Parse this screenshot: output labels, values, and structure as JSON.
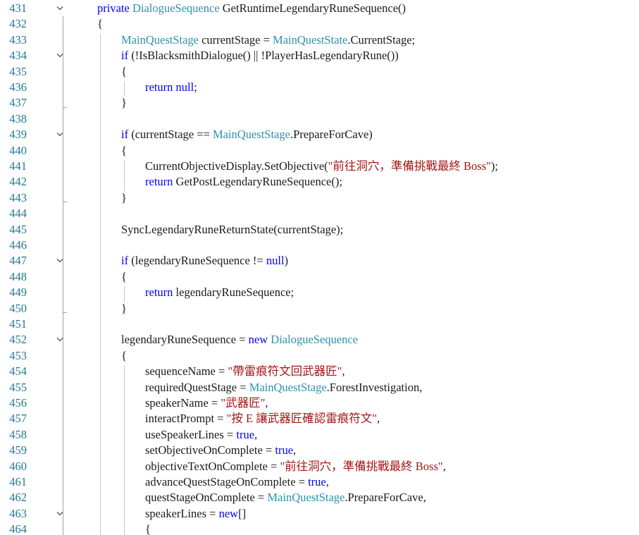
{
  "editor": {
    "language": "csharp",
    "colors": {
      "keyword": "#0000ff",
      "type": "#2b91af",
      "string": "#a31515",
      "plain": "#1a1a1a",
      "line_number": "#237893"
    },
    "lines": [
      {
        "num": "431",
        "indent": 0,
        "fold": true,
        "tokens": [
          [
            "kw",
            "private "
          ],
          [
            "type",
            "DialogueSequence"
          ],
          [
            "plain",
            " GetRuntimeLegendaryRuneSequence()"
          ]
        ]
      },
      {
        "num": "432",
        "indent": 0,
        "fold": false,
        "tokens": [
          [
            "plain",
            "{"
          ]
        ]
      },
      {
        "num": "433",
        "indent": 1,
        "fold": false,
        "tokens": [
          [
            "type",
            "MainQuestStage"
          ],
          [
            "plain",
            " currentStage = "
          ],
          [
            "type",
            "MainQuestState"
          ],
          [
            "plain",
            ".CurrentStage;"
          ]
        ]
      },
      {
        "num": "434",
        "indent": 1,
        "fold": true,
        "tokens": [
          [
            "kw",
            "if"
          ],
          [
            "plain",
            " (!IsBlacksmithDialogue() || !PlayerHasLegendaryRune())"
          ]
        ]
      },
      {
        "num": "435",
        "indent": 1,
        "fold": false,
        "tokens": [
          [
            "plain",
            "{"
          ]
        ]
      },
      {
        "num": "436",
        "indent": 2,
        "fold": false,
        "tokens": [
          [
            "kw",
            "return"
          ],
          [
            "plain",
            " "
          ],
          [
            "kw",
            "null"
          ],
          [
            "plain",
            ";"
          ]
        ]
      },
      {
        "num": "437",
        "indent": 1,
        "fold": false,
        "tokens": [
          [
            "plain",
            "}"
          ]
        ]
      },
      {
        "num": "438",
        "indent": 0,
        "fold": false,
        "tokens": []
      },
      {
        "num": "439",
        "indent": 1,
        "fold": true,
        "tokens": [
          [
            "kw",
            "if"
          ],
          [
            "plain",
            " (currentStage == "
          ],
          [
            "type",
            "MainQuestStage"
          ],
          [
            "plain",
            ".PrepareForCave)"
          ]
        ]
      },
      {
        "num": "440",
        "indent": 1,
        "fold": false,
        "tokens": [
          [
            "plain",
            "{"
          ]
        ]
      },
      {
        "num": "441",
        "indent": 2,
        "fold": false,
        "tokens": [
          [
            "plain",
            "CurrentObjectiveDisplay.SetObjective("
          ],
          [
            "str",
            "\"前往洞穴，準備挑戰最終 Boss\""
          ],
          [
            "plain",
            ");"
          ]
        ]
      },
      {
        "num": "442",
        "indent": 2,
        "fold": false,
        "tokens": [
          [
            "kw",
            "return"
          ],
          [
            "plain",
            " GetPostLegendaryRuneSequence();"
          ]
        ]
      },
      {
        "num": "443",
        "indent": 1,
        "fold": false,
        "tokens": [
          [
            "plain",
            "}"
          ]
        ]
      },
      {
        "num": "444",
        "indent": 0,
        "fold": false,
        "tokens": []
      },
      {
        "num": "445",
        "indent": 1,
        "fold": false,
        "tokens": [
          [
            "plain",
            "SyncLegendaryRuneReturnState(currentStage);"
          ]
        ]
      },
      {
        "num": "446",
        "indent": 0,
        "fold": false,
        "tokens": []
      },
      {
        "num": "447",
        "indent": 1,
        "fold": true,
        "tokens": [
          [
            "kw",
            "if"
          ],
          [
            "plain",
            " (legendaryRuneSequence != "
          ],
          [
            "kw",
            "null"
          ],
          [
            "plain",
            ")"
          ]
        ]
      },
      {
        "num": "448",
        "indent": 1,
        "fold": false,
        "tokens": [
          [
            "plain",
            "{"
          ]
        ]
      },
      {
        "num": "449",
        "indent": 2,
        "fold": false,
        "tokens": [
          [
            "kw",
            "return"
          ],
          [
            "plain",
            " legendaryRuneSequence;"
          ]
        ]
      },
      {
        "num": "450",
        "indent": 1,
        "fold": false,
        "tokens": [
          [
            "plain",
            "}"
          ]
        ]
      },
      {
        "num": "451",
        "indent": 0,
        "fold": false,
        "tokens": []
      },
      {
        "num": "452",
        "indent": 1,
        "fold": true,
        "tokens": [
          [
            "plain",
            "legendaryRuneSequence = "
          ],
          [
            "kw",
            "new"
          ],
          [
            "plain",
            " "
          ],
          [
            "type",
            "DialogueSequence"
          ]
        ]
      },
      {
        "num": "453",
        "indent": 1,
        "fold": false,
        "tokens": [
          [
            "plain",
            "{"
          ]
        ]
      },
      {
        "num": "454",
        "indent": 2,
        "fold": false,
        "tokens": [
          [
            "plain",
            "sequenceName = "
          ],
          [
            "str",
            "\"帶雷痕符文回武器匠\""
          ],
          [
            "plain",
            ","
          ]
        ]
      },
      {
        "num": "455",
        "indent": 2,
        "fold": false,
        "tokens": [
          [
            "plain",
            "requiredQuestStage = "
          ],
          [
            "type",
            "MainQuestStage"
          ],
          [
            "plain",
            ".ForestInvestigation,"
          ]
        ]
      },
      {
        "num": "456",
        "indent": 2,
        "fold": false,
        "tokens": [
          [
            "plain",
            "speakerName = "
          ],
          [
            "str",
            "\"武器匠\""
          ],
          [
            "plain",
            ","
          ]
        ]
      },
      {
        "num": "457",
        "indent": 2,
        "fold": false,
        "tokens": [
          [
            "plain",
            "interactPrompt = "
          ],
          [
            "str",
            "\"按 E 讓武器匠確認雷痕符文\""
          ],
          [
            "plain",
            ","
          ]
        ]
      },
      {
        "num": "458",
        "indent": 2,
        "fold": false,
        "tokens": [
          [
            "plain",
            "useSpeakerLines = "
          ],
          [
            "kw",
            "true"
          ],
          [
            "plain",
            ","
          ]
        ]
      },
      {
        "num": "459",
        "indent": 2,
        "fold": false,
        "tokens": [
          [
            "plain",
            "setObjectiveOnComplete = "
          ],
          [
            "kw",
            "true"
          ],
          [
            "plain",
            ","
          ]
        ]
      },
      {
        "num": "460",
        "indent": 2,
        "fold": false,
        "tokens": [
          [
            "plain",
            "objectiveTextOnComplete = "
          ],
          [
            "str",
            "\"前往洞穴，準備挑戰最終 Boss\""
          ],
          [
            "plain",
            ","
          ]
        ]
      },
      {
        "num": "461",
        "indent": 2,
        "fold": false,
        "tokens": [
          [
            "plain",
            "advanceQuestStageOnComplete = "
          ],
          [
            "kw",
            "true"
          ],
          [
            "plain",
            ","
          ]
        ]
      },
      {
        "num": "462",
        "indent": 2,
        "fold": false,
        "tokens": [
          [
            "plain",
            "questStageOnComplete = "
          ],
          [
            "type",
            "MainQuestStage"
          ],
          [
            "plain",
            ".PrepareForCave,"
          ]
        ]
      },
      {
        "num": "463",
        "indent": 2,
        "fold": true,
        "tokens": [
          [
            "plain",
            "speakerLines = "
          ],
          [
            "kw",
            "new"
          ],
          [
            "plain",
            "[]"
          ]
        ]
      },
      {
        "num": "464",
        "indent": 2,
        "fold": false,
        "tokens": [
          [
            "plain",
            "{"
          ]
        ]
      }
    ]
  }
}
